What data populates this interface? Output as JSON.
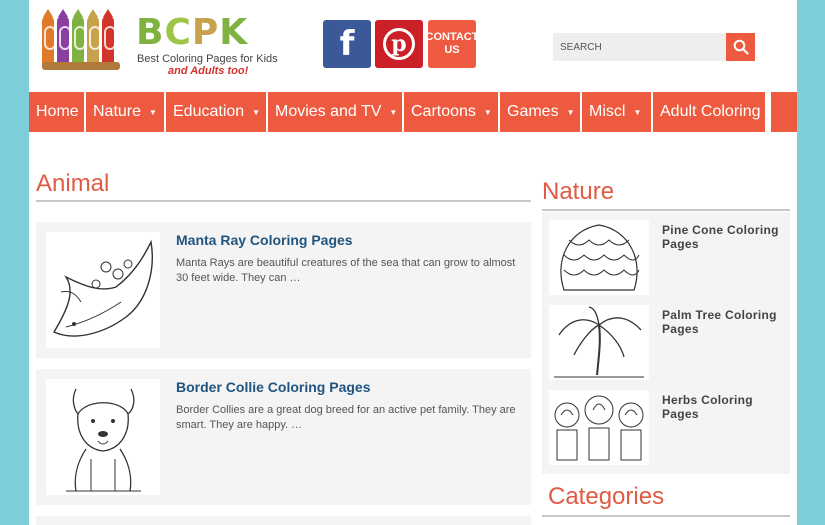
{
  "header": {
    "logo_text": "BCPK",
    "logo_tagline_1": "Best Coloring Pages for Kids",
    "logo_tagline_2": "and Adults too!",
    "facebook_icon": "facebook-icon",
    "pinterest_icon": "pinterest-icon",
    "contact_label_1": "CONTACT",
    "contact_label_2": "US",
    "search_placeholder": "SEARCH"
  },
  "nav": {
    "items": [
      {
        "label": "Home",
        "has_caret": false
      },
      {
        "label": "Nature",
        "has_caret": true
      },
      {
        "label": "Education",
        "has_caret": true
      },
      {
        "label": "Movies and TV",
        "has_caret": true
      },
      {
        "label": "Cartoons",
        "has_caret": true
      },
      {
        "label": "Games",
        "has_caret": true
      },
      {
        "label": "Miscl",
        "has_caret": true
      },
      {
        "label": "Adult Coloring",
        "has_caret": false
      }
    ],
    "caret": "▼"
  },
  "main": {
    "section_title": "Animal",
    "posts": [
      {
        "title": "Manta Ray Coloring Pages",
        "excerpt": "Manta Rays are beautiful creatures of the sea that can grow to almost 30 feet wide. They can …"
      },
      {
        "title": "Border Collie Coloring Pages",
        "excerpt": "Border Collies are a great dog breed for an active pet family. They are smart. They are happy. …"
      }
    ]
  },
  "sidebar": {
    "nature_title": "Nature",
    "nature_items": [
      {
        "label": "Pine Cone Coloring Pages"
      },
      {
        "label": "Palm Tree Coloring Pages"
      },
      {
        "label": "Herbs Coloring Pages"
      }
    ],
    "categories_title": "Categories"
  },
  "colors": {
    "accent": "#ee5a3f",
    "title_red": "#e05a44",
    "link_blue": "#21557f",
    "frame": "#7ccfd9",
    "facebook": "#3b5998",
    "pinterest": "#cb2027"
  }
}
